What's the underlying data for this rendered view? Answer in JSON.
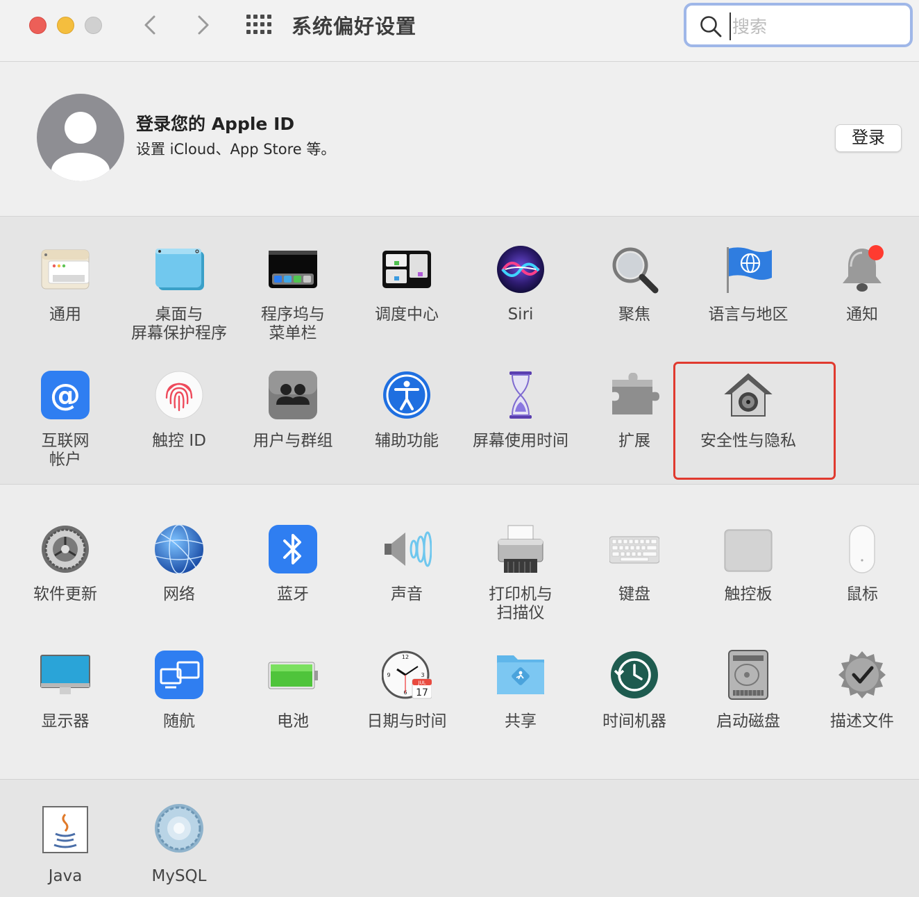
{
  "window": {
    "title": "系统偏好设置",
    "search_placeholder": "搜索"
  },
  "apple_id": {
    "title": "登录您的 Apple ID",
    "subtitle": "设置 iCloud、App Store 等。",
    "login_button": "登录"
  },
  "section1": {
    "items": [
      {
        "label": "通用",
        "icon": "general-icon"
      },
      {
        "label": "桌面与\n屏幕保护程序",
        "icon": "desktop-screensaver-icon"
      },
      {
        "label": "程序坞与\n菜单栏",
        "icon": "dock-menubar-icon"
      },
      {
        "label": "调度中心",
        "icon": "mission-control-icon"
      },
      {
        "label": "Siri",
        "icon": "siri-icon"
      },
      {
        "label": "聚焦",
        "icon": "spotlight-icon"
      },
      {
        "label": "语言与地区",
        "icon": "language-region-icon"
      },
      {
        "label": "通知",
        "icon": "notifications-icon"
      },
      {
        "label": "互联网\n帐户",
        "icon": "internet-accounts-icon"
      },
      {
        "label": "触控 ID",
        "icon": "touch-id-icon"
      },
      {
        "label": "用户与群组",
        "icon": "users-groups-icon"
      },
      {
        "label": "辅助功能",
        "icon": "accessibility-icon"
      },
      {
        "label": "屏幕使用时间",
        "icon": "screen-time-icon"
      },
      {
        "label": "扩展",
        "icon": "extensions-icon"
      },
      {
        "label": "安全性与隐私",
        "icon": "security-privacy-icon"
      }
    ]
  },
  "section2": {
    "items": [
      {
        "label": "软件更新",
        "icon": "software-update-icon"
      },
      {
        "label": "网络",
        "icon": "network-icon"
      },
      {
        "label": "蓝牙",
        "icon": "bluetooth-icon"
      },
      {
        "label": "声音",
        "icon": "sound-icon"
      },
      {
        "label": "打印机与\n扫描仪",
        "icon": "printers-scanners-icon"
      },
      {
        "label": "键盘",
        "icon": "keyboard-icon"
      },
      {
        "label": "触控板",
        "icon": "trackpad-icon"
      },
      {
        "label": "鼠标",
        "icon": "mouse-icon"
      },
      {
        "label": "显示器",
        "icon": "displays-icon"
      },
      {
        "label": "随航",
        "icon": "sidecar-icon"
      },
      {
        "label": "电池",
        "icon": "battery-icon"
      },
      {
        "label": "日期与时间",
        "icon": "date-time-icon"
      },
      {
        "label": "共享",
        "icon": "sharing-icon"
      },
      {
        "label": "时间机器",
        "icon": "time-machine-icon"
      },
      {
        "label": "启动磁盘",
        "icon": "startup-disk-icon"
      },
      {
        "label": "描述文件",
        "icon": "profiles-icon"
      }
    ]
  },
  "section3": {
    "items": [
      {
        "label": "Java",
        "icon": "java-icon"
      },
      {
        "label": "MySQL",
        "icon": "mysql-icon"
      }
    ]
  },
  "calendar_icon": {
    "month": "JUL",
    "day": "17"
  },
  "colors": {
    "highlight": "#e03a2f",
    "search_focus": "#9fb7e8"
  }
}
